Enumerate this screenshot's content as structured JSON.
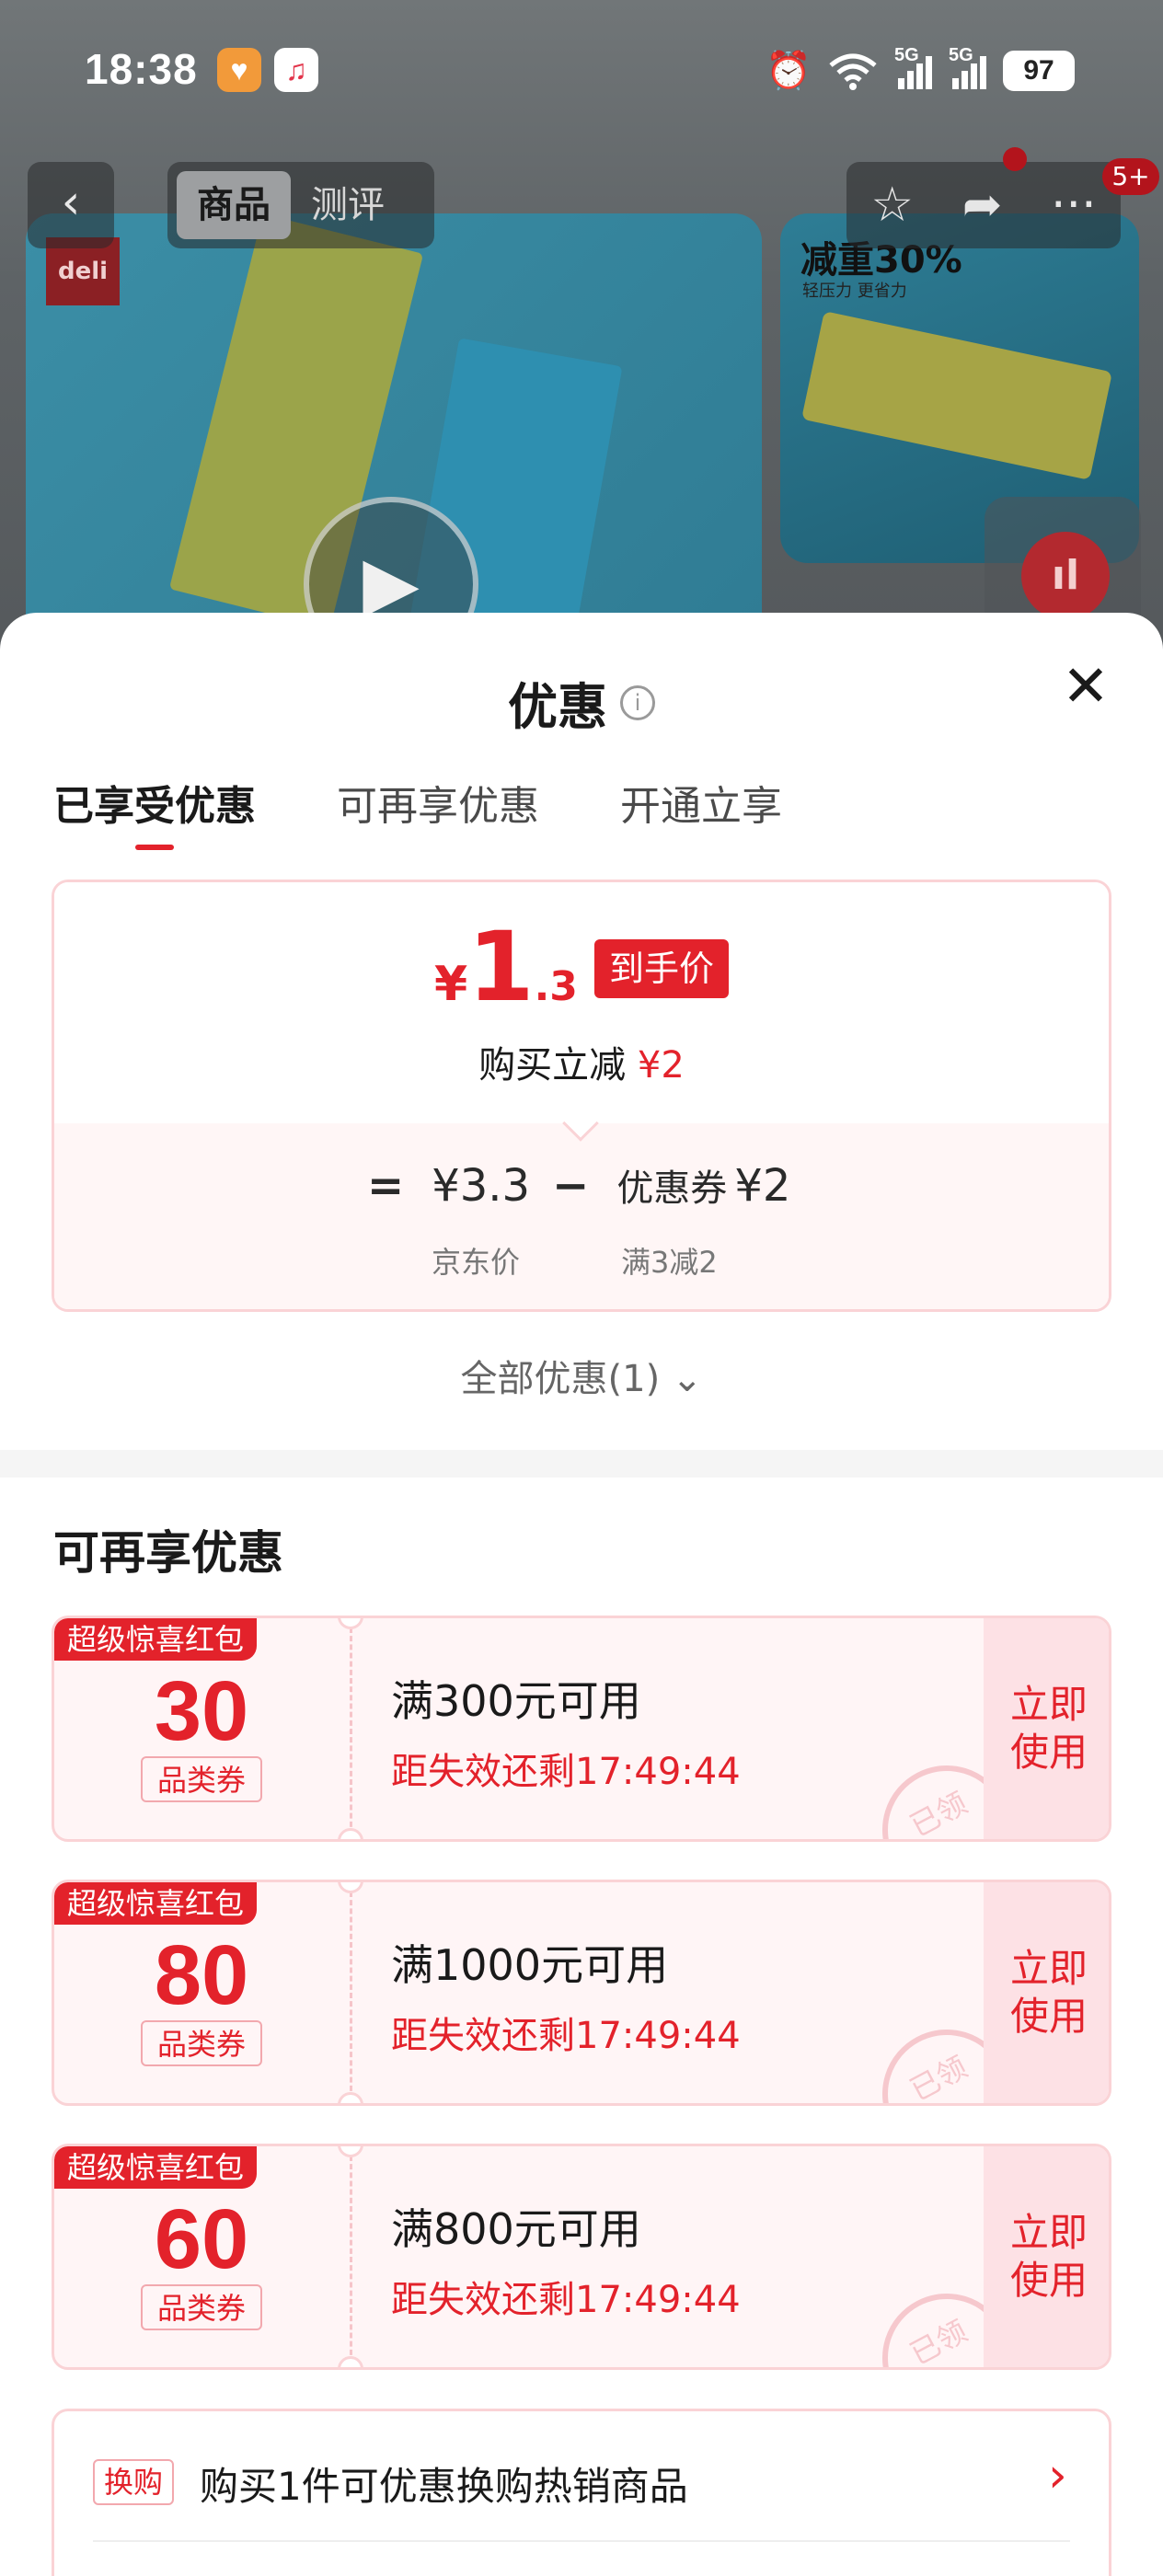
{
  "status_bar": {
    "time": "18:38",
    "battery": "97",
    "network_1": "5G",
    "network_2": "5G",
    "icons": [
      "app-notification-icon",
      "music-app-icon",
      "alarm-icon",
      "wifi-icon",
      "signal-icon",
      "battery-icon"
    ]
  },
  "product_page": {
    "back_icon": "‹",
    "tabs": [
      "商品",
      "测评"
    ],
    "actions": [
      "star-icon",
      "share-icon",
      "more-icon"
    ],
    "message_badge": "5+",
    "side_title": "减重30%",
    "side_subtitle": "轻压力 更省力",
    "brand": "deli"
  },
  "sheet": {
    "title": "优惠",
    "close_icon": "close-icon",
    "tabs": [
      {
        "label": "已享受优惠",
        "active": true
      },
      {
        "label": "可再享优惠",
        "active": false
      },
      {
        "label": "开通立享",
        "active": false
      }
    ],
    "summary": {
      "currency": "¥",
      "price_int": "1",
      "price_dec": ".3",
      "price_tag": "到手价",
      "save_text": "购买立减",
      "save_amount": "¥2",
      "eq": "=",
      "base_price": "¥3.3",
      "minus": "−",
      "coupon_label": "优惠券",
      "coupon_amount": "¥2",
      "base_label": "京东价",
      "coupon_rule": "满3减2"
    },
    "all_offers": "全部优惠(1)",
    "section_title": "可再享优惠",
    "coupons": [
      {
        "badge": "超级惊喜红包",
        "amount": "30",
        "type": "品类券",
        "condition": "满300元可用",
        "expire": "距失效还剩17:49:44",
        "action": "立即\n使用",
        "stamp": "已领"
      },
      {
        "badge": "超级惊喜红包",
        "amount": "80",
        "type": "品类券",
        "condition": "满1000元可用",
        "expire": "距失效还剩17:49:44",
        "action": "立即\n使用",
        "stamp": "已领"
      },
      {
        "badge": "超级惊喜红包",
        "amount": "60",
        "type": "品类券",
        "condition": "满800元可用",
        "expire": "距失效还剩17:49:44",
        "action": "立即\n使用",
        "stamp": "已领"
      }
    ],
    "exchange": {
      "tag": "换购",
      "text": "购买1件可优惠换购热销商品",
      "arrow": "›"
    }
  }
}
